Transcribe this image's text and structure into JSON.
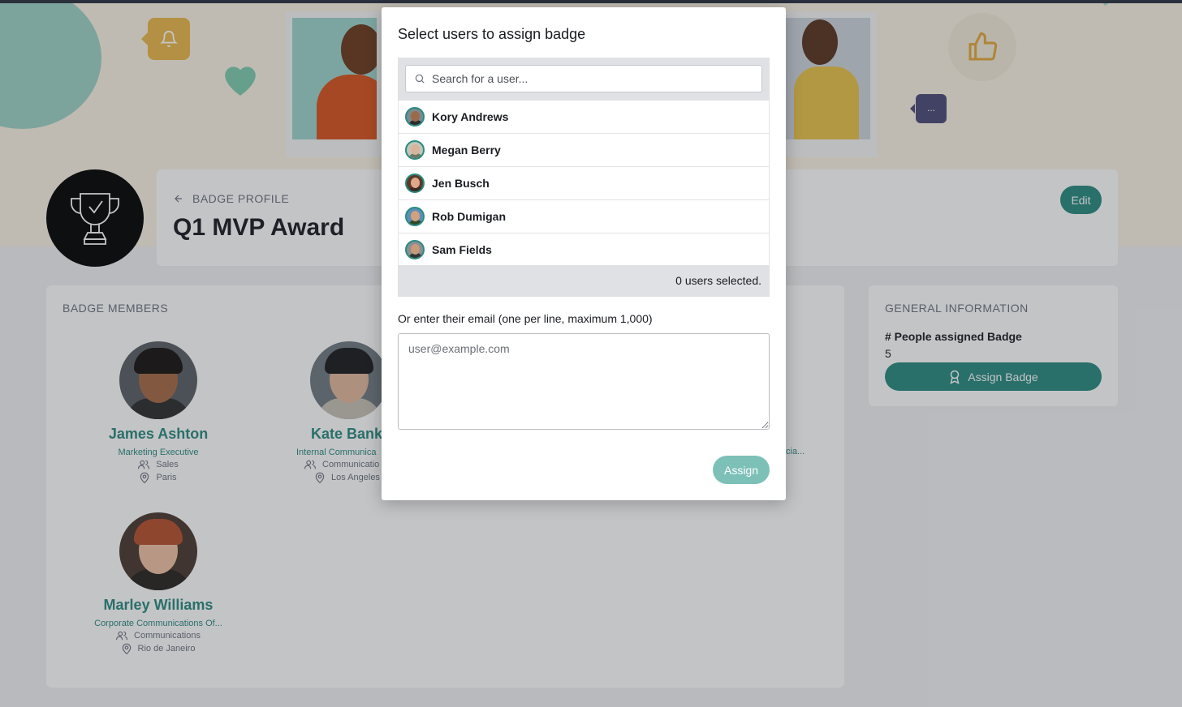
{
  "page": {
    "back_label": "BADGE PROFILE",
    "badge_title": "Q1 MVP Award",
    "edit_label": "Edit",
    "chat_glyph": "...",
    "accent_color": "#2a8a80"
  },
  "members": {
    "heading": "BADGE MEMBERS",
    "items": [
      {
        "name": "James Ashton",
        "role": "Marketing Executive",
        "department": "Sales",
        "location": "Paris"
      },
      {
        "name": "Kate Banks",
        "role": "Internal Communica",
        "department": "Communicatio",
        "location": "Los Angeles"
      },
      {
        "name": "Marley Williams",
        "role": "Corporate Communications Of...",
        "department": "Communications",
        "location": "Rio de Janeiro"
      }
    ],
    "partial_role_fragment": "cia..."
  },
  "general_info": {
    "heading": "GENERAL INFORMATION",
    "people_label": "# People assigned Badge",
    "people_count": "5",
    "assign_badge_label": "Assign Badge"
  },
  "modal": {
    "title": "Select users to assign badge",
    "search_placeholder": "Search for a user...",
    "users": [
      {
        "name": "Kory Andrews"
      },
      {
        "name": "Megan Berry"
      },
      {
        "name": "Jen Busch"
      },
      {
        "name": "Rob Dumigan"
      },
      {
        "name": "Sam Fields"
      }
    ],
    "selected_text": "0 users selected.",
    "email_label": "Or enter their email (one per line, maximum 1,000)",
    "email_placeholder": "user@example.com",
    "assign_label": "Assign"
  }
}
